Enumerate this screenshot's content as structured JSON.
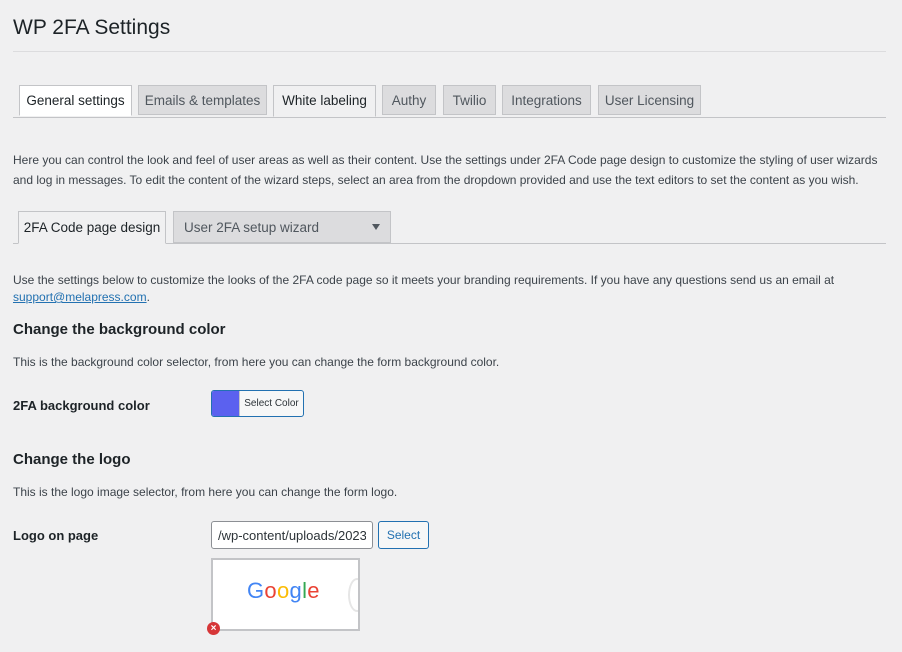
{
  "page": {
    "title": "WP 2FA Settings"
  },
  "tabs": [
    {
      "label": "General settings"
    },
    {
      "label": "Emails & templates"
    },
    {
      "label": "White labeling"
    },
    {
      "label": "Authy"
    },
    {
      "label": "Twilio"
    },
    {
      "label": "Integrations"
    },
    {
      "label": "User Licensing"
    }
  ],
  "intro": "Here you can control the look and feel of user areas as well as their content. Use the settings under 2FA Code page design to customize the styling of user wizards and log in messages. To edit the content of the wizard steps, select an area from the dropdown provided and use the text editors to set the content as you wish.",
  "subtabs": {
    "active_label": "2FA Code page design",
    "dropdown_label": "User 2FA setup wizard"
  },
  "code_page": {
    "description": "Use the settings below to customize the looks of the 2FA code page so it meets your branding requirements. If you have any questions send us an email at",
    "email": "support@melapress.com",
    "email_suffix": "."
  },
  "background": {
    "heading": "Change the background color",
    "description": "This is the background color selector, from here you can change the form background color.",
    "label": "2FA background color",
    "button_label": "Select Color",
    "color": "#5b61ef"
  },
  "logo": {
    "heading": "Change the logo",
    "description": "This is the logo image selector, from here you can change the form logo.",
    "label": "Logo on page",
    "input_value": "/wp-content/uploads/2023",
    "select_label": "Select",
    "preview_text": "Google",
    "preview_letter_colors": [
      "#4285f4",
      "#ea4335",
      "#fbbc05",
      "#4285f4",
      "#34a853",
      "#ea4335"
    ],
    "remove_icon": "remove-icon"
  }
}
